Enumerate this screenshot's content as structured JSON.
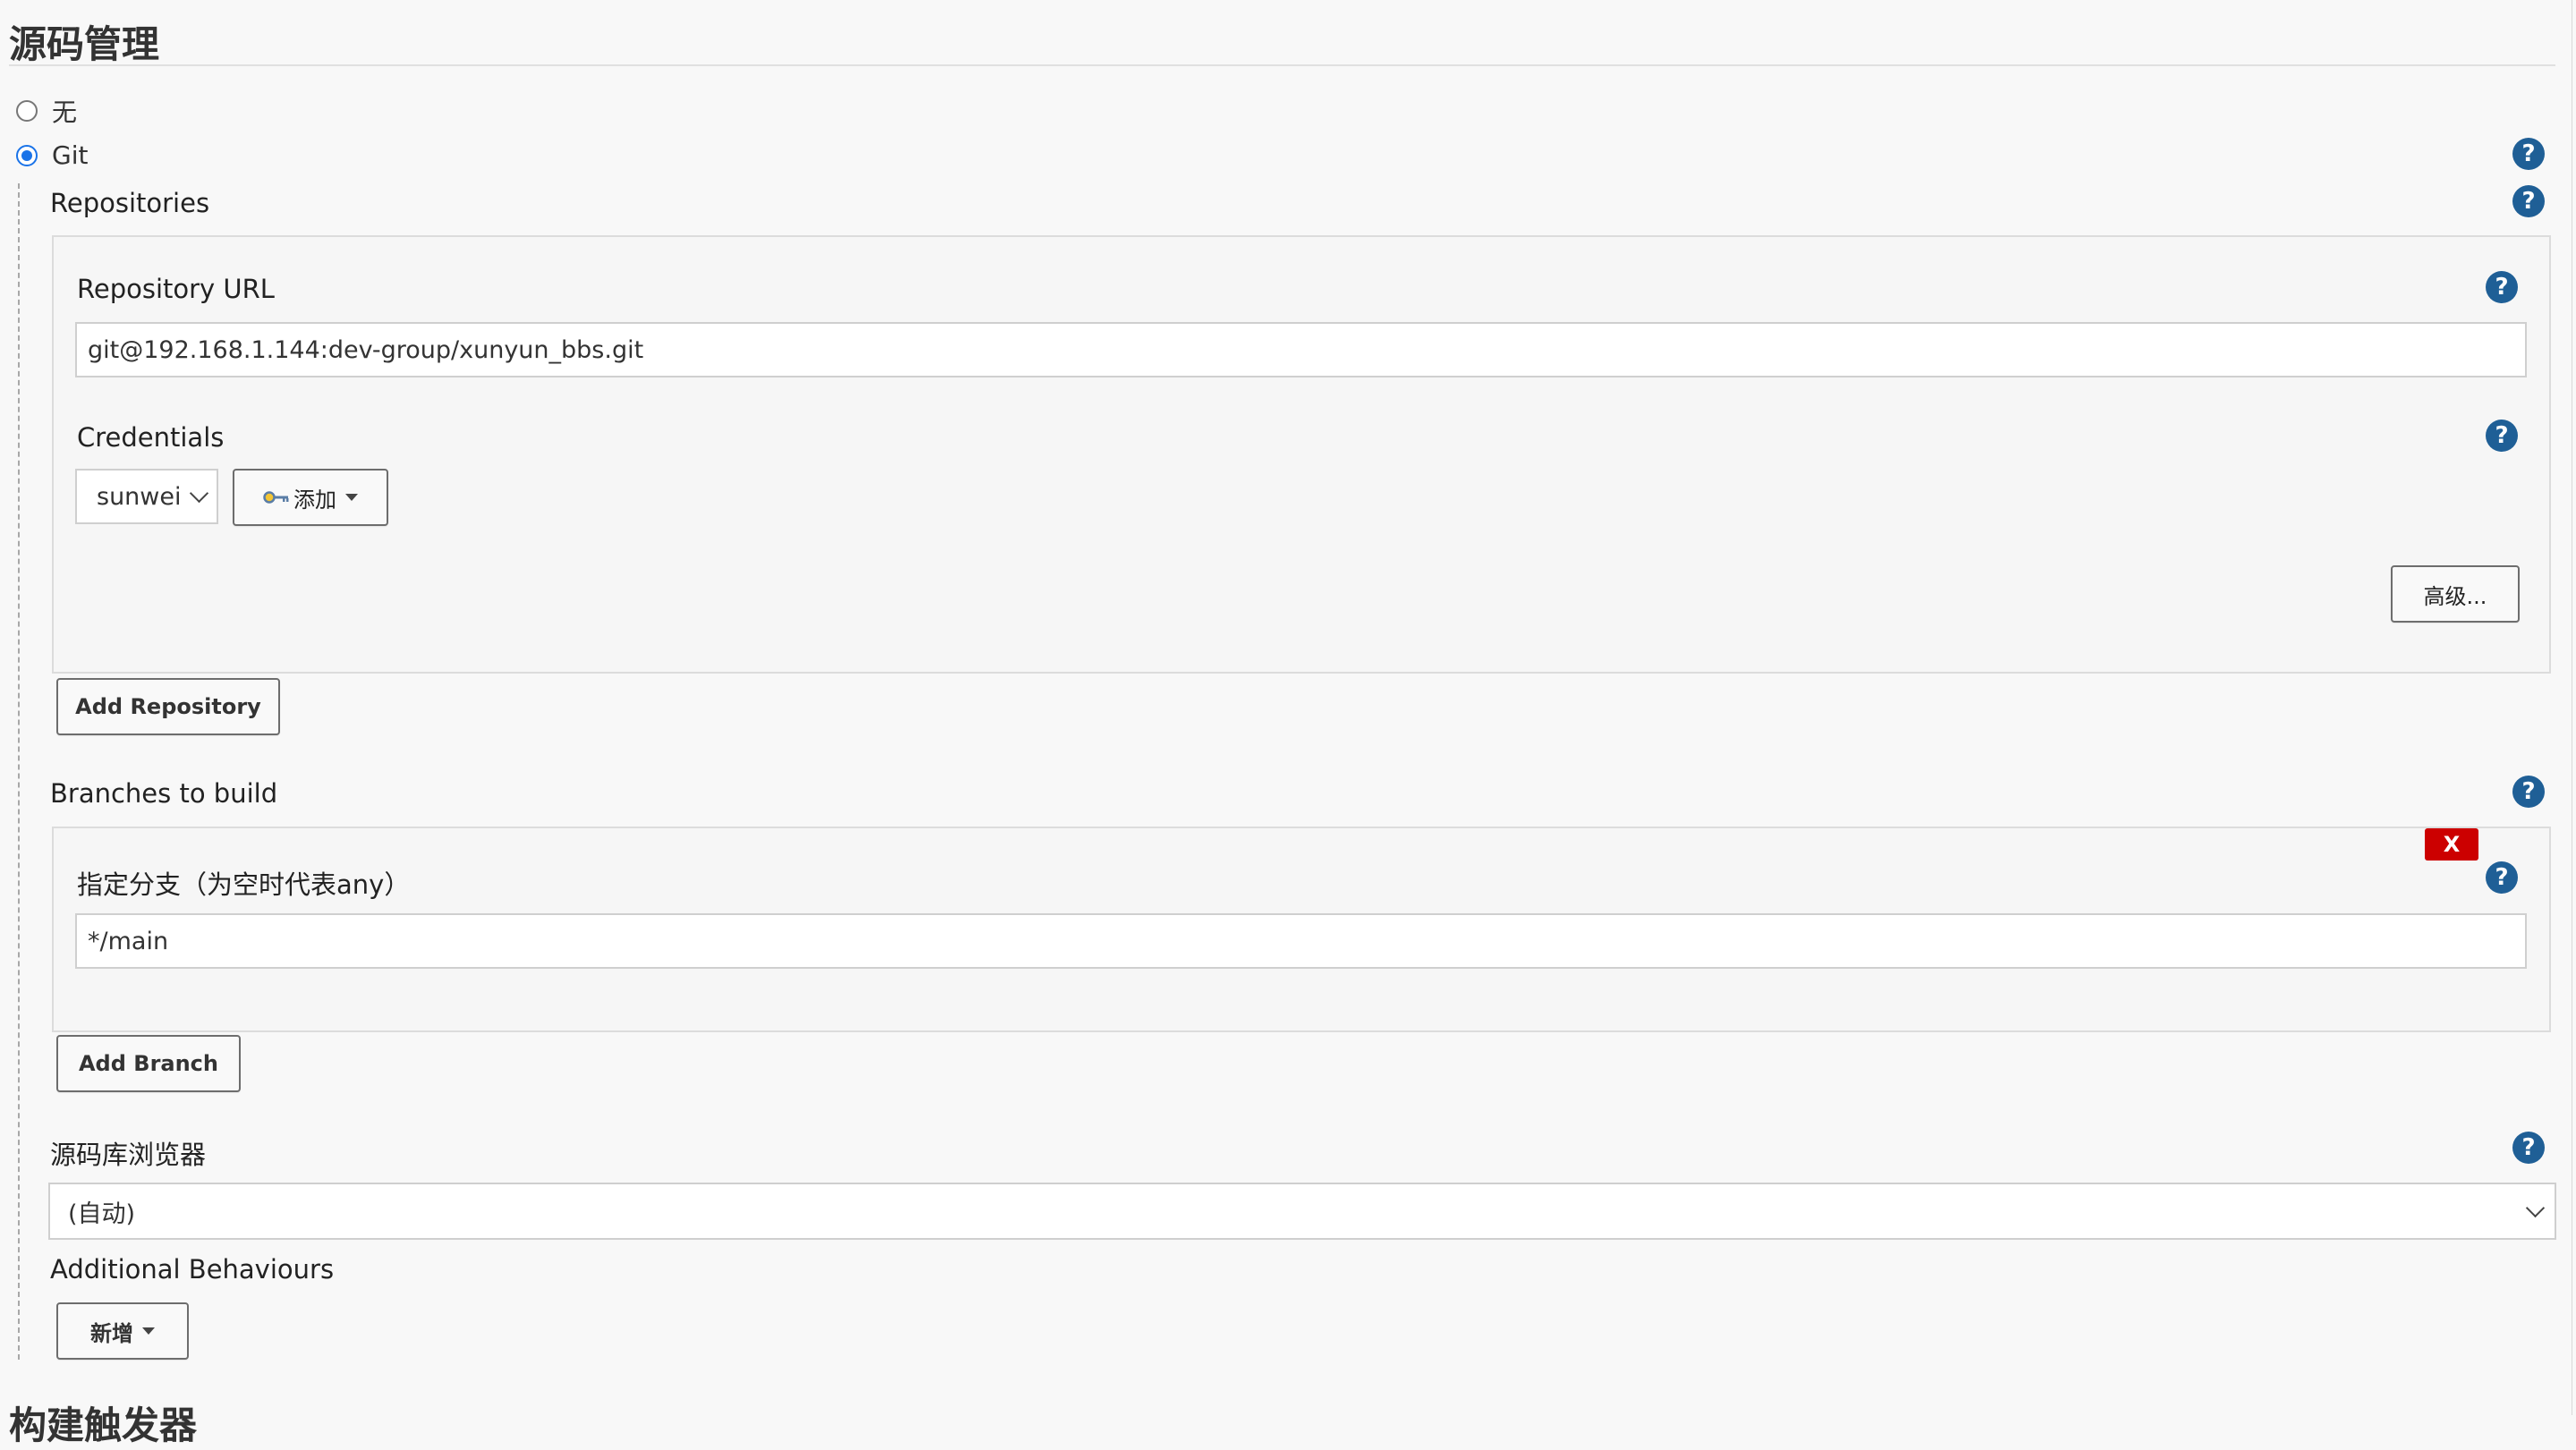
{
  "section": {
    "title": "源码管理",
    "next_title": "构建触发器"
  },
  "scm_options": [
    {
      "label": "无",
      "selected": false
    },
    {
      "label": "Git",
      "selected": true
    }
  ],
  "repositories": {
    "label": "Repositories",
    "repository_url_label": "Repository URL",
    "repository_url_value": "git@192.168.1.144:dev-group/xunyun_bbs.git",
    "credentials_label": "Credentials",
    "credentials_selected": "sunwei",
    "add_credentials_label": "添加",
    "advanced_label": "高级...",
    "add_repository_label": "Add Repository"
  },
  "branches": {
    "label": "Branches to build",
    "branch_specifier_label": "指定分支（为空时代表any）",
    "branch_specifier_value": "*/main",
    "delete_label": "X",
    "add_branch_label": "Add Branch"
  },
  "browser": {
    "label": "源码库浏览器",
    "selected": "(自动)"
  },
  "behaviours": {
    "label": "Additional Behaviours",
    "add_label": "新增"
  },
  "help_glyph": "?",
  "colors": {
    "help_icon": "#1f5f96",
    "radio_selected": "#1a73e8",
    "delete_button": "#cc0000",
    "background": "#f8f8f8"
  },
  "icons": {
    "help": "question-circle-icon",
    "key": "key-icon",
    "caret": "caret-down-icon",
    "chevron": "chevron-down-icon"
  }
}
